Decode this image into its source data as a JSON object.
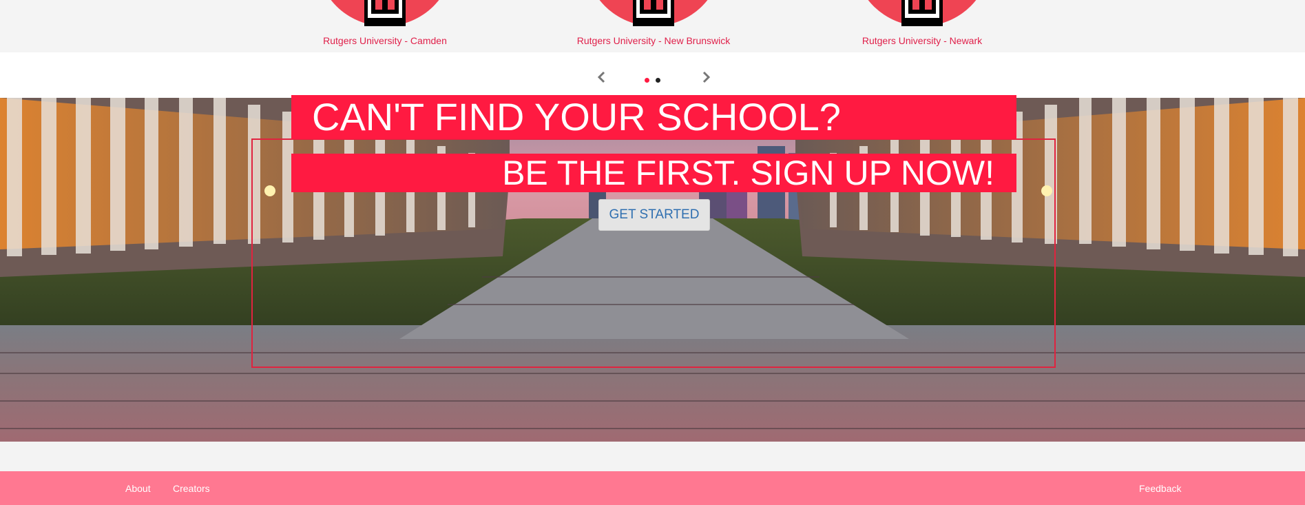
{
  "schools": [
    {
      "name": "Rutgers University - Camden",
      "logo_icon": "rutgers-r-logo-icon"
    },
    {
      "name": "Rutgers University - New Brunswick",
      "logo_icon": "rutgers-r-logo-icon"
    },
    {
      "name": "Rutgers University - Newark",
      "logo_icon": "rutgers-r-logo-icon"
    }
  ],
  "carousel": {
    "prev_icon": "chevron-left-icon",
    "next_icon": "chevron-right-icon",
    "pages": 2,
    "active_page": 1
  },
  "hero": {
    "headline": "CAN'T FIND YOUR SCHOOL?",
    "subheadline": "BE THE FIRST. SIGN UP NOW!",
    "cta_label": "GET STARTED"
  },
  "footer": {
    "links_left": [
      "About",
      "Creators"
    ],
    "link_right": "Feedback"
  },
  "colors": {
    "accent_red": "#ff1a41",
    "school_name": "#e0204a",
    "footer_bg": "#ff7891",
    "cta_text": "#2f6fb0"
  }
}
